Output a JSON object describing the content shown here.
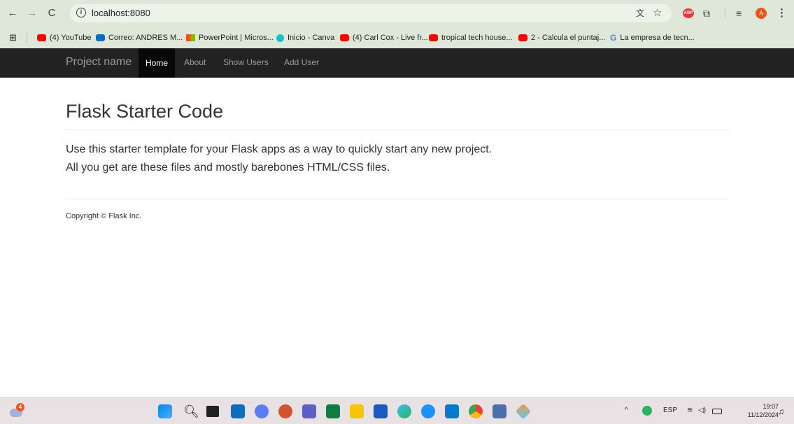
{
  "browser": {
    "url": "localhost:8080",
    "bookmarks": [
      {
        "label": "(4) YouTube",
        "color": "#ff0000"
      },
      {
        "label": "Correo: ANDRES M...",
        "color": "#0f6cbd"
      },
      {
        "label": "PowerPoint | Micros...",
        "color": "#d35230"
      },
      {
        "label": "Inicio - Canva",
        "color": "#00c4cc"
      },
      {
        "label": "(4) Carl Cox - Live fr...",
        "color": "#ff0000"
      },
      {
        "label": "tropical tech house...",
        "color": "#ff0000"
      },
      {
        "label": "2 - Calcula el puntaj...",
        "color": "#ff0000"
      },
      {
        "label": "La empresa de tecn...",
        "color": "#4285f4"
      }
    ]
  },
  "navbar": {
    "brand": "Project name",
    "links": [
      "Home",
      "About",
      "Show Users",
      "Add User"
    ]
  },
  "main": {
    "title": "Flask Starter Code",
    "lead_line1": "Use this starter template for your Flask apps as a way to quickly start any new project.",
    "lead_line2": "All you get are these files and mostly barebones HTML/CSS files."
  },
  "footer": {
    "copyright": "Copyright © Flask Inc."
  },
  "taskbar": {
    "weather_badge": "4",
    "language": "ESP",
    "time": "19:07",
    "date": "11/12/2024"
  },
  "colors": {
    "navbar_bg": "#222222",
    "browser_chrome": "#dfe8d8",
    "taskbar_bg": "#e8e2e4"
  }
}
